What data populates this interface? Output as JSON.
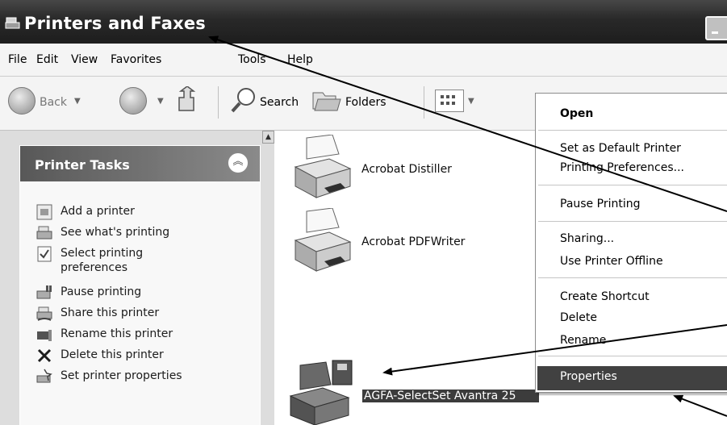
{
  "window": {
    "title": "Printers and Faxes"
  },
  "menubar": {
    "items": [
      "File",
      "Edit",
      "View",
      "Favorites",
      "Tools",
      "Help"
    ]
  },
  "toolbar": {
    "back_label": "Back",
    "search_label": "Search",
    "folders_label": "Folders"
  },
  "taskpane": {
    "header": "Printer Tasks",
    "items": [
      {
        "label": "Add a printer",
        "icon": "add-printer-icon"
      },
      {
        "label": "See what's printing",
        "icon": "printer-queue-icon"
      },
      {
        "label": "Select printing",
        "label2": "preferences",
        "icon": "preferences-icon"
      },
      {
        "label": "Pause printing",
        "icon": "pause-printer-icon"
      },
      {
        "label": "Share this printer",
        "icon": "share-printer-icon"
      },
      {
        "label": "Rename this printer",
        "icon": "rename-printer-icon"
      },
      {
        "label": "Delete this printer",
        "icon": "delete-x-icon"
      },
      {
        "label": "Set printer properties",
        "icon": "printer-properties-icon"
      }
    ]
  },
  "printers": [
    {
      "name": "Acrobat Distiller"
    },
    {
      "name": "Acrobat PDFWriter"
    },
    {
      "name": "AGFA-SelectSet Avantra 25"
    }
  ],
  "context_menu": {
    "open": "Open",
    "set_default": "Set as Default Printer",
    "printing_prefs": "Printing Preferences...",
    "pause": "Pause Printing",
    "sharing": "Sharing...",
    "offline": "Use Printer Offline",
    "create_shortcut": "Create Shortcut",
    "delete": "Delete",
    "rename": "Rename",
    "properties": "Properties"
  }
}
